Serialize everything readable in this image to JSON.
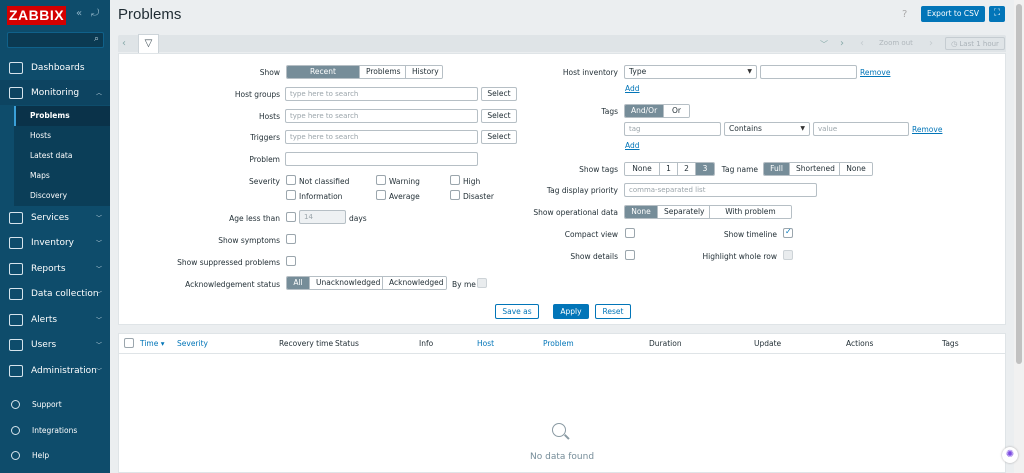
{
  "app": {
    "logo": "ZABBIX",
    "collapse_icon": "«",
    "kiosk_icon": "⤾"
  },
  "sidebar": {
    "search_placeholder": "",
    "menu": [
      {
        "label": "Dashboards"
      },
      {
        "label": "Monitoring",
        "submenu": [
          "Problems",
          "Hosts",
          "Latest data",
          "Maps",
          "Discovery"
        ]
      },
      {
        "label": "Services"
      },
      {
        "label": "Inventory"
      },
      {
        "label": "Reports"
      },
      {
        "label": "Data collection"
      },
      {
        "label": "Alerts"
      },
      {
        "label": "Users"
      },
      {
        "label": "Administration"
      }
    ],
    "bottom": [
      "Support",
      "Integrations",
      "Help"
    ]
  },
  "header": {
    "title": "Problems",
    "help": "?",
    "export_label": "Export to CSV"
  },
  "timebar": {
    "zoom_label": "Zoom out",
    "period_label": "Last 1 hour"
  },
  "filter": {
    "show_label": "Show",
    "show_options": [
      "Recent problems",
      "Problems",
      "History"
    ],
    "host_groups_label": "Host groups",
    "hosts_label": "Hosts",
    "triggers_label": "Triggers",
    "search_placeholder": "type here to search",
    "select_label": "Select",
    "problem_label": "Problem",
    "severity_label": "Severity",
    "severities": [
      "Not classified",
      "Warning",
      "High",
      "Information",
      "Average",
      "Disaster"
    ],
    "age_label": "Age less than",
    "age_value": "14",
    "age_unit": "days",
    "symptoms_label": "Show symptoms",
    "suppressed_label": "Show suppressed problems",
    "ack_label": "Acknowledgement status",
    "ack_options": [
      "All",
      "Unacknowledged",
      "Acknowledged"
    ],
    "by_me_label": "By me",
    "inventory_label": "Host inventory",
    "inventory_field": "Type",
    "remove_label": "Remove",
    "add_label": "Add",
    "tags_label": "Tags",
    "tags_ops": [
      "And/Or",
      "Or"
    ],
    "tag_placeholder": "tag",
    "tag_op": "Contains",
    "value_placeholder": "value",
    "show_tags_label": "Show tags",
    "show_tags_options": [
      "None",
      "1",
      "2",
      "3"
    ],
    "tag_name_label": "Tag name",
    "tag_name_options": [
      "Full",
      "Shortened",
      "None"
    ],
    "tag_priority_label": "Tag display priority",
    "tag_priority_placeholder": "comma-separated list",
    "opdata_label": "Show operational data",
    "opdata_options": [
      "None",
      "Separately",
      "With problem name"
    ],
    "compact_label": "Compact view",
    "timeline_label": "Show timeline",
    "timeline_checked": true,
    "details_label": "Show details",
    "highlight_label": "Highlight whole row",
    "save_as_label": "Save as",
    "apply_label": "Apply",
    "reset_label": "Reset"
  },
  "table": {
    "columns": [
      "Time ▾",
      "Severity",
      "Recovery time",
      "Status",
      "Info",
      "Host",
      "Problem",
      "Duration",
      "Update",
      "Actions",
      "Tags"
    ],
    "empty": "No data found"
  },
  "colors": {
    "brand": "#d40000",
    "sidebar": "#0e4c6b",
    "accent": "#0275b8"
  }
}
